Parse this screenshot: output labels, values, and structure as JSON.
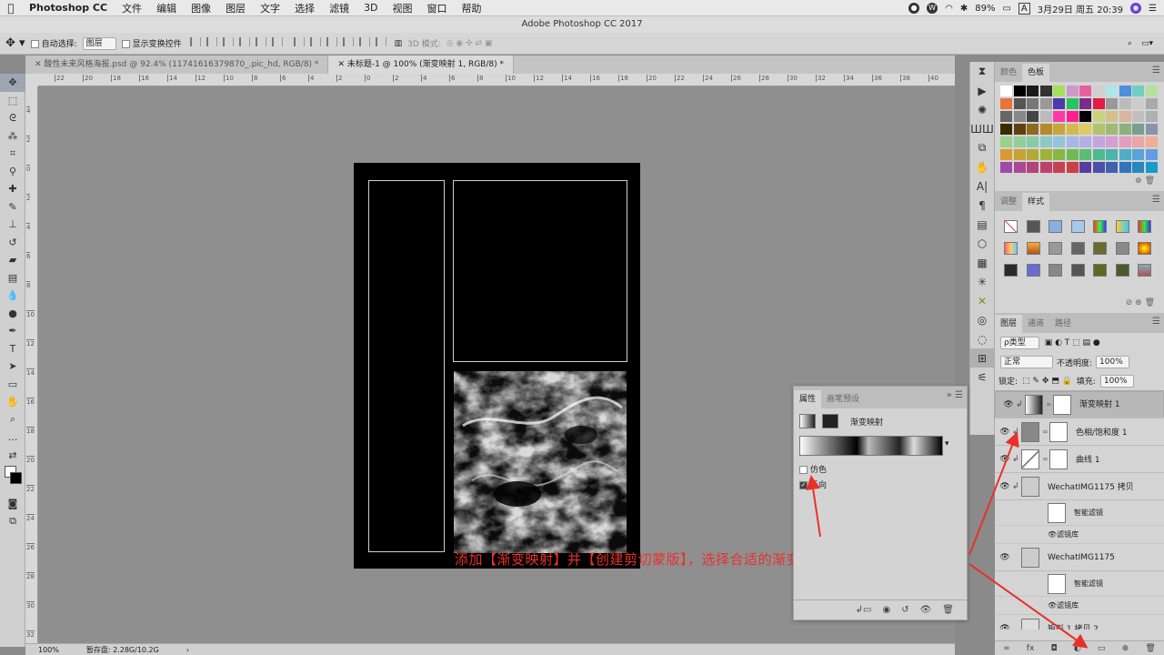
{
  "menubar": {
    "app": "Photoshop CC",
    "items": [
      "文件",
      "编辑",
      "图像",
      "图层",
      "文字",
      "选择",
      "滤镜",
      "3D",
      "视图",
      "窗口",
      "帮助"
    ],
    "battery": "89%",
    "date_time": "3月29日 周五 20:39",
    "input": "A"
  },
  "window_title": "Adobe Photoshop CC 2017",
  "options": {
    "auto_select_label": "自动选择:",
    "auto_select_value": "图层",
    "show_transform_label": "显示变换控件",
    "mode_3d_label": "3D 模式:"
  },
  "tabs": [
    {
      "label": "酸性未来风格海报.psd @ 92.4% (11741616379870_.pic_hd, RGB/8) *"
    },
    {
      "label": "未标题-1 @ 100% (渐变映射 1, RGB/8) *"
    }
  ],
  "ruler": {
    "h_ticks": [
      "22",
      "20",
      "18",
      "16",
      "14",
      "12",
      "10",
      "8",
      "6",
      "4",
      "2",
      "0",
      "2",
      "4",
      "6",
      "8",
      "10",
      "12",
      "14",
      "16",
      "18",
      "20",
      "22",
      "24",
      "26",
      "28",
      "30",
      "32",
      "34",
      "36",
      "38",
      "40",
      "42"
    ],
    "v_ticks": [
      "4",
      "2",
      "0",
      "2",
      "4",
      "6",
      "8",
      "10",
      "12",
      "14",
      "16",
      "18",
      "20",
      "22",
      "24",
      "26",
      "28",
      "30",
      "32"
    ]
  },
  "status": {
    "zoom": "100%",
    "memory": "暂存盘: 2.28G/10.2G"
  },
  "caption": "添加【渐变映射】并【创建剪切蒙版】，选择合适的渐变色，勾选反向",
  "properties": {
    "tab_props": "属性",
    "tab_brush": "画笔预设",
    "type_label": "渐变映射",
    "dither_label": "仿色",
    "dither_checked": false,
    "reverse_label": "反向",
    "reverse_checked": true
  },
  "panels": {
    "color_tab": "颜色",
    "swatches_tab": "色板",
    "adjust_tab": "调整",
    "styles_tab": "样式",
    "layers_tab": "图层",
    "channels_tab": "通道",
    "paths_tab": "路径"
  },
  "layers_panel": {
    "filter_label": "ρ类型",
    "blend_mode": "正常",
    "opacity_label": "不透明度:",
    "opacity": "100%",
    "lock_label": "锁定:",
    "fill_label": "填充:",
    "fill": "100%"
  },
  "layers": [
    {
      "name": "渐变映射 1",
      "selected": true
    },
    {
      "name": "色相/饱和度 1"
    },
    {
      "name": "曲线 1"
    },
    {
      "name": "WechatIMG1175 拷贝"
    },
    {
      "name": "WechatIMG1175"
    },
    {
      "name": "矩形 1 拷贝 2"
    }
  ],
  "smart_filter_label": "智能滤镜",
  "filter_gallery_label": "滤镜库",
  "swatch_colors": [
    "#ffffff",
    "#000000",
    "#1a1a1a",
    "#333333",
    "#a6e05a",
    "#cc99cc",
    "#e85fa0",
    "#d0d0d0",
    "#b0e6ea",
    "#4a8fe0",
    "#6fd0c0",
    "#b5e0a0",
    "#e8743b",
    "#555555",
    "#777777",
    "#999999",
    "#4b3ca8",
    "#22c55e",
    "#7c2d8a",
    "#e11d48",
    "#999999",
    "#bbbbbb",
    "#cccccc",
    "#aaaaaa",
    "#666666",
    "#888888",
    "#444444",
    "#bbbbbb",
    "#ff3aa7",
    "#ff1f8f",
    "#000000",
    "#c9d37a",
    "#d6c08a",
    "#d8b5a0",
    "#c0c0c0",
    "#b0b0b0",
    "#3a2a00",
    "#5e4010",
    "#8d6a1f",
    "#b58a2d",
    "#c7a53a",
    "#d4b94c",
    "#e0c960",
    "#b2c46a",
    "#9fbb72",
    "#8cb07e",
    "#7a9e8e",
    "#8795a8",
    "#9ad18b",
    "#8fcf9b",
    "#86ccab",
    "#8dc8c5",
    "#98c2dc",
    "#a4b7e6",
    "#b4aee6",
    "#c4a5e0",
    "#d59fd1",
    "#e29cbd",
    "#eca4a7",
    "#f1ae97",
    "#d99a2e",
    "#c6a232",
    "#b4a934",
    "#9fb238",
    "#84b842",
    "#6cbb55",
    "#5abd71",
    "#4fba90",
    "#4bb4ad",
    "#4fadc7",
    "#58a3da",
    "#679ae4",
    "#9e4aa8",
    "#a84894",
    "#b24580",
    "#bb436b",
    "#c44156",
    "#cc3f42",
    "#5a3ca0",
    "#4d4ea8",
    "#4061b0",
    "#3374b8",
    "#2687c0",
    "#1a9ac8"
  ]
}
